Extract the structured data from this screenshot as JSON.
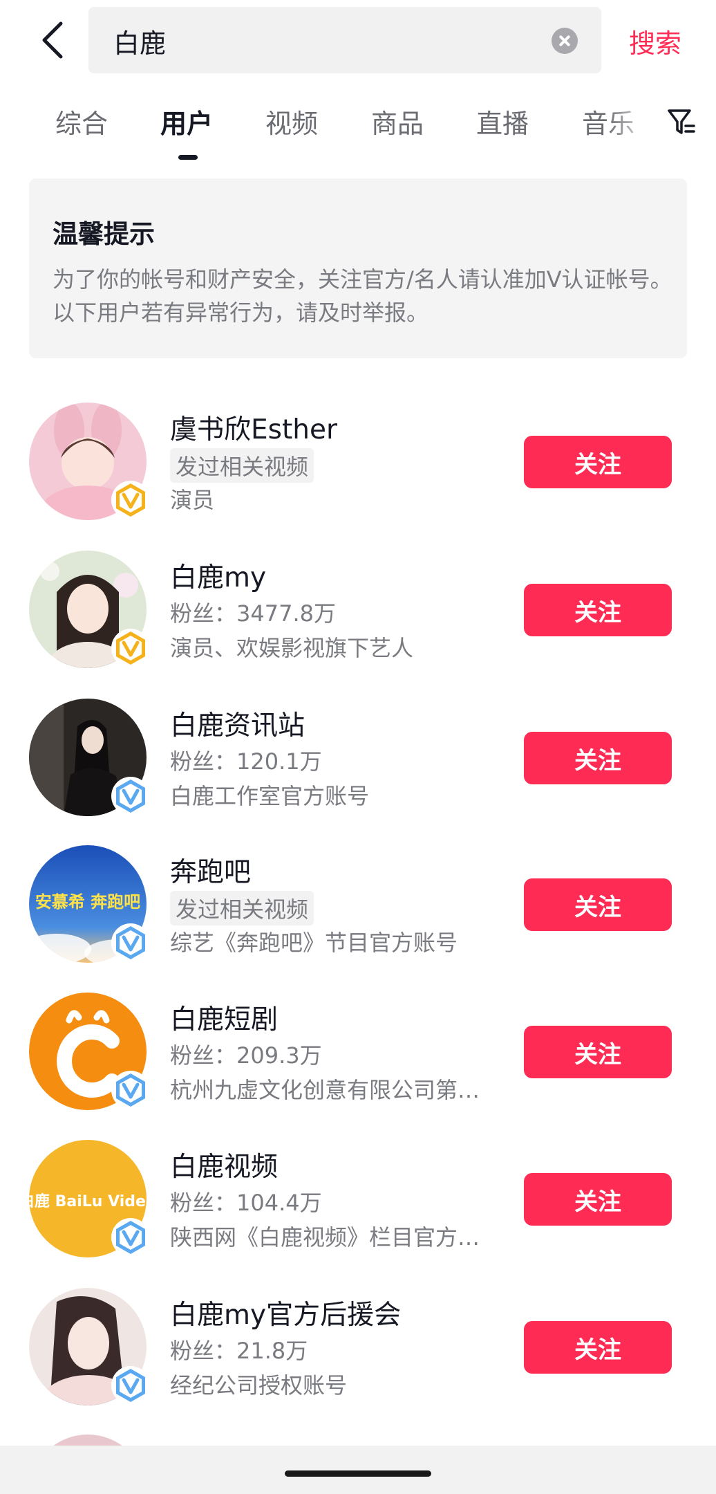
{
  "search": {
    "value": "白鹿",
    "submit_label": "搜索"
  },
  "tabs": [
    {
      "label": "综合",
      "active": false
    },
    {
      "label": "用户",
      "active": true
    },
    {
      "label": "视频",
      "active": false
    },
    {
      "label": "商品",
      "active": false
    },
    {
      "label": "直播",
      "active": false
    },
    {
      "label": "音乐",
      "active": false
    }
  ],
  "notice": {
    "title": "温馨提示",
    "text": "为了你的帐号和财产安全，关注官方/名人请认准加V认证帐号。以下用户若有异常行为，请及时举报。"
  },
  "users": [
    {
      "name": "虞书欣Esther",
      "line2": "发过相关视频",
      "line2_is_tag": true,
      "line3": "演员",
      "badge": "gold",
      "follow_label": "关注"
    },
    {
      "name": "白鹿my",
      "line2": "粉丝：3477.8万",
      "line2_is_tag": false,
      "line3": "演员、欢娱影视旗下艺人",
      "badge": "gold",
      "follow_label": "关注"
    },
    {
      "name": "白鹿资讯站",
      "line2": "粉丝：120.1万",
      "line2_is_tag": false,
      "line3": "白鹿工作室官方账号",
      "badge": "blue",
      "follow_label": "关注"
    },
    {
      "name": "奔跑吧",
      "line2": "发过相关视频",
      "line2_is_tag": true,
      "line3": "综艺《奔跑吧》节目官方账号",
      "badge": "blue",
      "follow_label": "关注"
    },
    {
      "name": "白鹿短剧",
      "line2": "粉丝：209.3万",
      "line2_is_tag": false,
      "line3": "杭州九虚文化创意有限公司第…",
      "badge": "blue",
      "follow_label": "关注"
    },
    {
      "name": "白鹿视频",
      "line2": "粉丝：104.4万",
      "line2_is_tag": false,
      "line3": "陕西网《白鹿视频》栏目官方…",
      "badge": "blue",
      "follow_label": "关注"
    },
    {
      "name": "白鹿my官方后援会",
      "line2": "粉丝：21.8万",
      "line2_is_tag": false,
      "line3": "经纪公司授权账号",
      "badge": "blue",
      "follow_label": "关注"
    }
  ],
  "logos": {
    "user_3": "安慕希 奔跑吧",
    "user_5": "白鹿 BaiLu Video"
  },
  "colors": {
    "accent": "#fe2c55",
    "verified_gold": "#f5b21b",
    "verified_blue": "#5aa8f0"
  }
}
